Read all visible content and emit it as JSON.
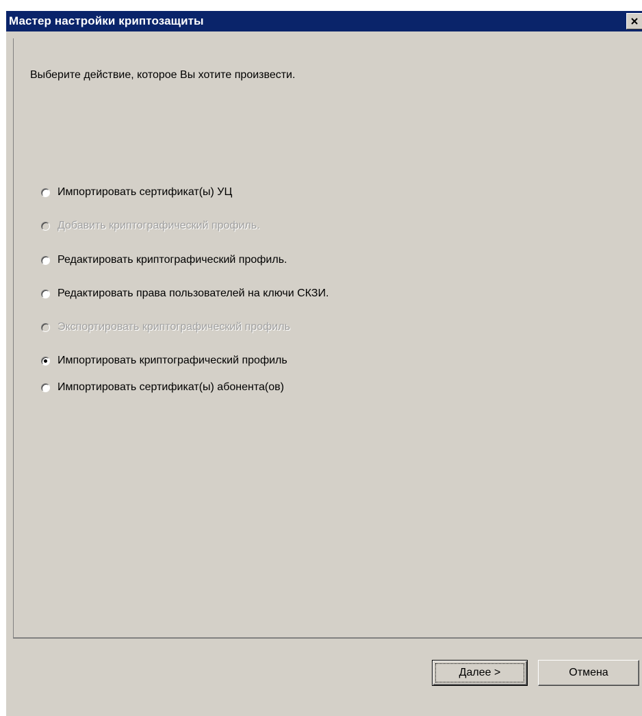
{
  "window": {
    "title": "Мастер настройки криптозащиты"
  },
  "instruction": "Выберите действие, которое Вы хотите произвести.",
  "options": [
    {
      "label": "Импортировать сертификат(ы) УЦ",
      "enabled": true,
      "selected": false
    },
    {
      "label": "Добавить криптографический профиль.",
      "enabled": false,
      "selected": false
    },
    {
      "label": "Редактировать криптографический профиль.",
      "enabled": true,
      "selected": false
    },
    {
      "label": "Редактировать права пользователей на ключи СКЗИ.",
      "enabled": true,
      "selected": false
    },
    {
      "label": "Экспортировать криптографический профиль",
      "enabled": false,
      "selected": false
    },
    {
      "label": "Импортировать  криптографический профиль",
      "enabled": true,
      "selected": true
    },
    {
      "label": "Импортировать сертификат(ы) абонента(ов)",
      "enabled": true,
      "selected": false
    }
  ],
  "buttons": {
    "next": "Далее >",
    "cancel": "Отмена"
  },
  "colors": {
    "titlebar": "#0a246a",
    "face": "#d4d0c8",
    "disabled_text": "#a0a0a0"
  },
  "icons": {
    "close": "close-icon"
  }
}
